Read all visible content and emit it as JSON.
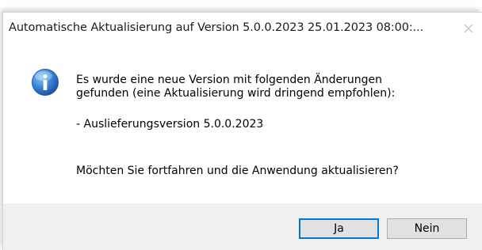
{
  "window": {
    "title": "Automatische Aktualisierung auf Version 5.0.0.2023 25.01.2023 08:00:..."
  },
  "message": {
    "line1": "Es wurde eine neue Version mit folgenden Änderungen",
    "line2": "gefunden (eine Aktualisierung wird dringend empfohlen):",
    "changes": "- Auslieferungsversion 5.0.0.2023",
    "question": "Möchten Sie fortfahren und die Anwendung aktualisieren?"
  },
  "icon": "info-icon",
  "buttons": {
    "yes_label": "Ja",
    "no_label": "Nein"
  },
  "colors": {
    "accent": "#0078d7",
    "footer": "#f0f0f0",
    "icon_blue": "#2a6fc9"
  }
}
